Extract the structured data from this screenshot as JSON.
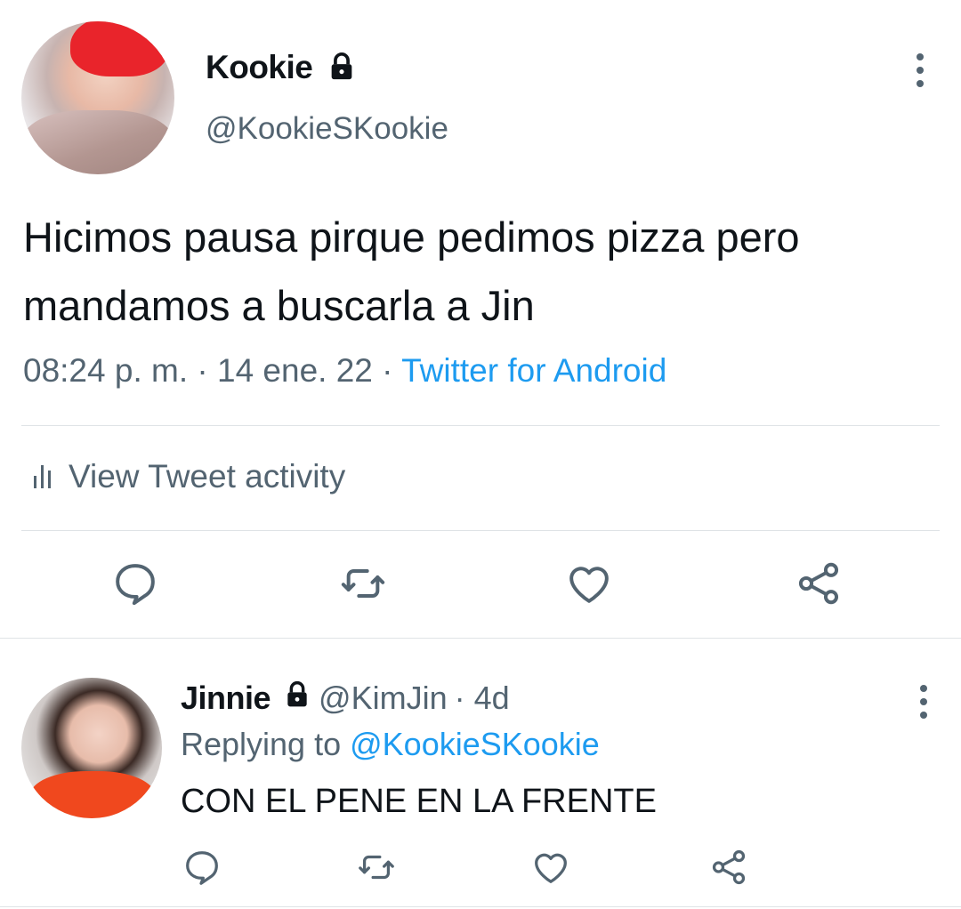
{
  "tweet": {
    "author": {
      "display_name": "Kookie",
      "handle": "@KookieSKookie",
      "protected_icon": "lock-icon"
    },
    "text": "Hicimos pausa pirque pedimos pizza pero mandamos a buscarla a Jin",
    "time": "08:24 p. m.",
    "separator": "·",
    "date": "14 ene. 22",
    "source": "Twitter for Android",
    "activity_label": "View Tweet activity",
    "more_icon": "more-vertical-icon",
    "actions": [
      "reply-icon",
      "retweet-icon",
      "like-icon",
      "share-icon"
    ]
  },
  "reply": {
    "author": {
      "display_name": "Jinnie",
      "handle": "@KimJin",
      "protected_icon": "lock-icon"
    },
    "age": "· 4d",
    "replying_prefix": "Replying to",
    "replying_to": "@KookieSKookie",
    "text": "CON EL PENE EN LA FRENTE",
    "actions": [
      "reply-icon",
      "retweet-icon",
      "like-icon",
      "share-icon"
    ]
  },
  "colors": {
    "text": "#0f1419",
    "secondary": "#536471",
    "link": "#1d9bf0",
    "divider": "#dfe3e6"
  }
}
